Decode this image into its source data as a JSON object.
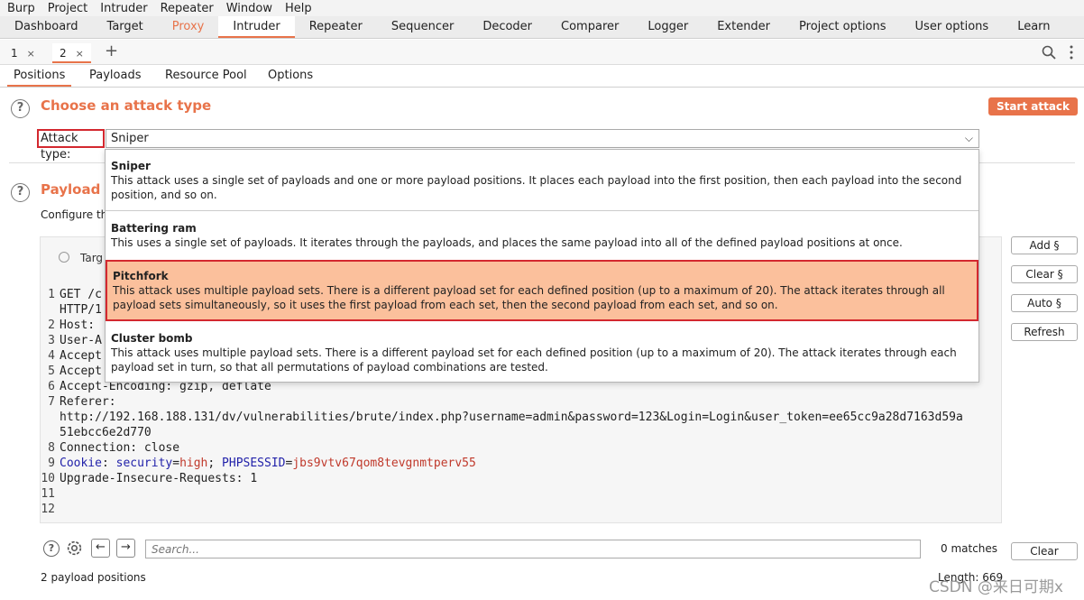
{
  "menubar": [
    "Burp",
    "Project",
    "Intruder",
    "Repeater",
    "Window",
    "Help"
  ],
  "main_tabs": [
    "Dashboard",
    "Target",
    "Proxy",
    "Intruder",
    "Repeater",
    "Sequencer",
    "Decoder",
    "Comparer",
    "Logger",
    "Extender",
    "Project options",
    "User options",
    "Learn"
  ],
  "request_tabs": [
    {
      "label": "1",
      "close": "×"
    },
    {
      "label": "2",
      "close": "×"
    }
  ],
  "plus": "+",
  "sub_tabs": [
    "Positions",
    "Payloads",
    "Resource Pool",
    "Options"
  ],
  "attack": {
    "help": "?",
    "title": "Choose an attack type",
    "start_button": "Start attack",
    "label": "Attack type:",
    "selected": "Sniper",
    "chevron": "⌵",
    "options": [
      {
        "title": "Sniper",
        "desc": "This attack uses a single set of payloads and one or more payload positions. It places each payload into the first position, then each payload into the second position, and so on."
      },
      {
        "title": "Battering ram",
        "desc": "This uses a single set of payloads. It iterates through the payloads, and places the same payload into all of the defined payload positions at once."
      },
      {
        "title": "Pitchfork",
        "desc": "This attack uses multiple payload sets. There is a different payload set for each defined position (up to a maximum of 20). The attack iterates through all payload sets simultaneously, so it uses the first payload from each set, then the second payload from each set, and so on."
      },
      {
        "title": "Cluster bomb",
        "desc": "This attack uses multiple payload sets. There is a different payload set for each defined position (up to a maximum of 20). The attack iterates through each payload set in turn, so that all permutations of payload combinations are tested."
      }
    ]
  },
  "positions": {
    "help": "?",
    "title": "Payload Po",
    "configure": "Configure th",
    "target_label": "Targ",
    "buttons": {
      "add": "Add §",
      "clear": "Clear §",
      "auto": "Auto §",
      "refresh": "Refresh"
    }
  },
  "request_lines": [
    {
      "n": "1",
      "text": "GET /c"
    },
    {
      "n": "",
      "text": "HTTP/1"
    },
    {
      "n": "2",
      "text": "Host:"
    },
    {
      "n": "3",
      "text": "User-A"
    },
    {
      "n": "4",
      "text": "Accept"
    },
    {
      "n": "5",
      "text": "Accept"
    },
    {
      "n": "6",
      "text": "Accept-Encoding: gzip, deflate"
    },
    {
      "n": "7",
      "text": "Referer:"
    },
    {
      "n": "",
      "text": "http://192.168.188.131/dv/vulnerabilities/brute/index.php?username=admin&password=123&Login=Login&user_token=ee65cc9a28d7163d59a"
    },
    {
      "n": "",
      "text": "51ebcc6e2d770"
    },
    {
      "n": "8",
      "text": "Connection: close"
    },
    {
      "n": "9",
      "text": "Cookie: security=high; PHPSESSID=jbs9vtv67qom8tevgnmtperv55"
    },
    {
      "n": "10",
      "text": "Upgrade-Insecure-Requests: 1"
    },
    {
      "n": "11",
      "text": ""
    },
    {
      "n": "12",
      "text": ""
    }
  ],
  "cookie": {
    "key": "Cookie",
    "security_key": "security",
    "security_val": "high",
    "sess_key": "PHPSESSID",
    "sess_val": "jbs9vtv67qom8tevgnmtperv55"
  },
  "bottom": {
    "search_placeholder": "Search...",
    "matches": "0 matches",
    "clear": "Clear",
    "payload_positions": "2 payload positions",
    "length": "Length: 669",
    "prev": "←",
    "next": "→",
    "help": "?"
  },
  "watermark": "CSDN @来日可期x"
}
